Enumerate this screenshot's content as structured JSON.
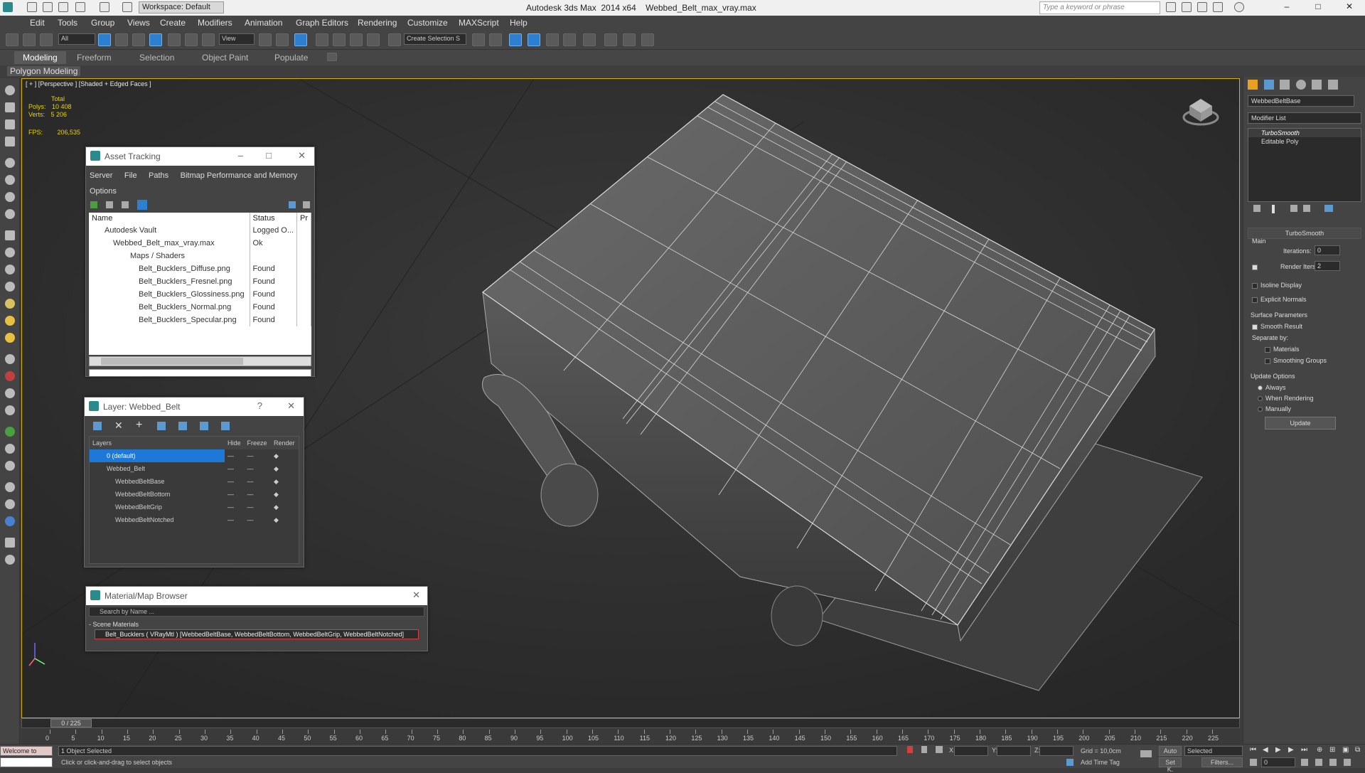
{
  "title_bar": {
    "title": "Autodesk 3ds Max  2014 x64    Webbed_Belt_max_vray.max",
    "workspace": "Workspace: Default",
    "search_placeholder": "Type a keyword or phrase",
    "minimize": "–",
    "maximize": "□",
    "close": "✕"
  },
  "menu": [
    "Edit",
    "Tools",
    "Group",
    "Views",
    "Create",
    "Modifiers",
    "Animation",
    "Graph Editors",
    "Rendering",
    "Customize",
    "MAXScript",
    "Help"
  ],
  "toolbar": {
    "filter": "All",
    "ref_coord": "View",
    "selection_set": "Create Selection S"
  },
  "ribbon": {
    "tabs": [
      "Modeling",
      "Freeform",
      "Selection",
      "Object Paint",
      "Populate"
    ],
    "panel_label": "Polygon Modeling"
  },
  "viewport": {
    "label": "[ + ] [Perspective ] [Shaded + Edged Faces ]",
    "stats_header": "Total",
    "polys_label": "Polys:",
    "polys_value": "10 408",
    "verts_label": "Verts:",
    "verts_value": "5 206",
    "fps_label": "FPS:",
    "fps_value": "206,535"
  },
  "asset_tracking": {
    "title": "Asset Tracking",
    "menu": [
      "Server",
      "File",
      "Paths",
      "Bitmap Performance and Memory"
    ],
    "menu2": "Options",
    "columns": [
      "Name",
      "Status",
      "Pr"
    ],
    "rows": [
      {
        "name": "Autodesk Vault",
        "status": "Logged O..."
      },
      {
        "name": "Webbed_Belt_max_vray.max",
        "status": "Ok"
      },
      {
        "name": "Maps / Shaders",
        "status": ""
      },
      {
        "name": "Belt_Bucklers_Diffuse.png",
        "status": "Found"
      },
      {
        "name": "Belt_Bucklers_Fresnel.png",
        "status": "Found"
      },
      {
        "name": "Belt_Bucklers_Glossiness.png",
        "status": "Found"
      },
      {
        "name": "Belt_Bucklers_Normal.png",
        "status": "Found"
      },
      {
        "name": "Belt_Bucklers_Specular.png",
        "status": "Found"
      }
    ]
  },
  "layer_window": {
    "title": "Layer: Webbed_Belt",
    "help": "?",
    "columns": [
      "Layers",
      "Hide",
      "Freeze",
      "Render"
    ],
    "rows": [
      {
        "name": "0 (default)"
      },
      {
        "name": "Webbed_Belt"
      },
      {
        "name": "WebbedBeltBase"
      },
      {
        "name": "WebbedBeltBottom"
      },
      {
        "name": "WebbedBeltGrip"
      },
      {
        "name": "WebbedBeltNotched"
      }
    ]
  },
  "material_browser": {
    "title": "Material/Map Browser",
    "search_placeholder": "Search by Name ...",
    "section": "- Scene Materials",
    "item": "Belt_Bucklers ( VRayMtl ) [WebbedBeltBase, WebbedBeltBottom, WebbedBeltGrip, WebbedBeltNotched]"
  },
  "command_panel": {
    "object_name": "WebbedBeltBase",
    "modifier_list": "Modifier List",
    "stack": [
      "TurboSmooth",
      "Editable Poly"
    ],
    "rollout_title": "TurboSmooth",
    "main_label": "Main",
    "iterations_label": "Iterations:",
    "iterations_value": "0",
    "render_iters_label": "Render Iters:",
    "render_iters_value": "2",
    "isoline": "Isoline Display",
    "explicit_normals": "Explicit Normals",
    "surface_params": "Surface Parameters",
    "smooth_result": "Smooth Result",
    "separate_by": "Separate by:",
    "materials": "Materials",
    "smoothing_groups": "Smoothing Groups",
    "update_options": "Update Options",
    "always": "Always",
    "when_rendering": "When Rendering",
    "manually": "Manually",
    "update_btn": "Update"
  },
  "timeline": {
    "frame": "0 / 225",
    "ticks": [
      "0",
      "5",
      "10",
      "15",
      "20",
      "25",
      "30",
      "35",
      "40",
      "45",
      "50",
      "55",
      "60",
      "65",
      "70",
      "75",
      "80",
      "85",
      "90",
      "95",
      "100",
      "105",
      "110",
      "115",
      "120",
      "125",
      "130",
      "135",
      "140",
      "145",
      "150",
      "155",
      "160",
      "165",
      "170",
      "175",
      "180",
      "185",
      "190",
      "195",
      "200",
      "205",
      "210",
      "215",
      "220",
      "225"
    ]
  },
  "status": {
    "welcome": "Welcome to",
    "selected": "1 Object Selected",
    "prompt": "Click or click-and-drag to select objects",
    "x_label": "X:",
    "y_label": "Y:",
    "z_label": "Z:",
    "grid": "Grid = 10,0cm",
    "add_time_tag": "Add Time Tag",
    "auto": "Auto",
    "set_key": "Set K.",
    "key_mode": "Selected",
    "filters": "Filters...",
    "frame_value": "0"
  }
}
